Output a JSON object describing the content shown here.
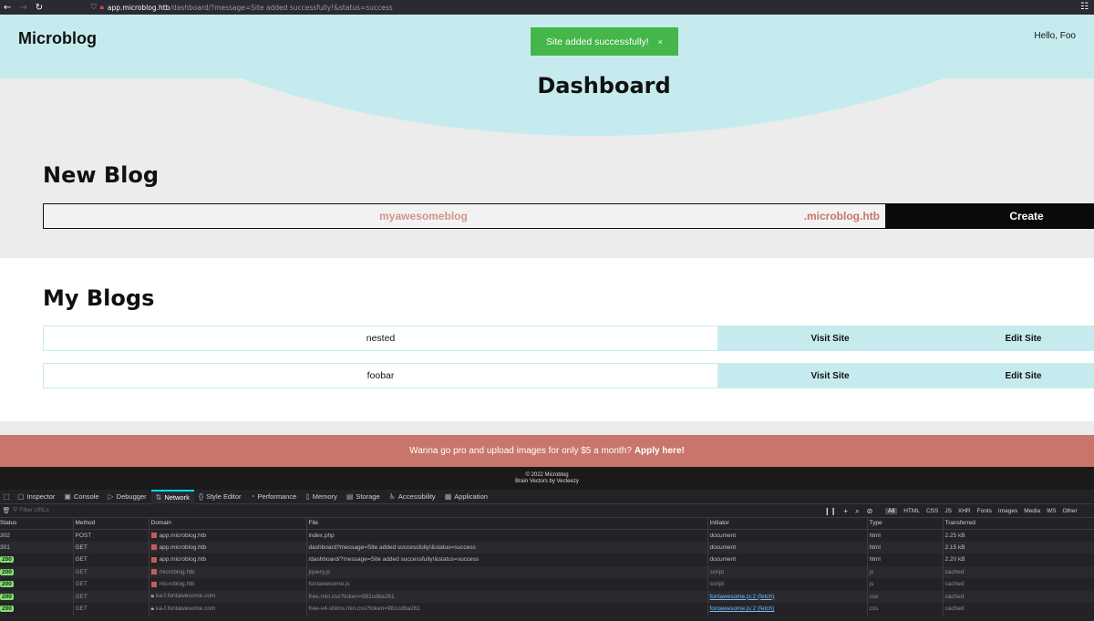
{
  "browser": {
    "url_host": "app.microblog.htb",
    "url_path": "/dashboard/?message=Site added successfully!&status=success"
  },
  "site": {
    "brand": "Microblog",
    "greeting": "Hello, Foo",
    "toast": {
      "message": "Site added successfully!",
      "close": "×"
    },
    "page_title": "Dashboard"
  },
  "new_blog": {
    "heading": "New Blog",
    "input_placeholder": "myawesomeblog",
    "suffix": ".microblog.htb",
    "create_label": "Create"
  },
  "my_blogs": {
    "heading": "My Blogs",
    "items": [
      {
        "name": "nested",
        "visit_label": "Visit Site",
        "edit_label": "Edit Site"
      },
      {
        "name": "foobar",
        "visit_label": "Visit Site",
        "edit_label": "Edit Site"
      }
    ]
  },
  "promo": {
    "text": "Wanna go pro and upload images for only $5 a month?",
    "link": "Apply here!"
  },
  "footer": {
    "copyright": "© 2022 Microblog",
    "credit": "Brain Vectors by Vecteezy"
  },
  "devtools": {
    "tabs": [
      "Inspector",
      "Console",
      "Debugger",
      "Network",
      "Style Editor",
      "Performance",
      "Memory",
      "Storage",
      "Accessibility",
      "Application"
    ],
    "active_tab": "Network",
    "filter_placeholder": "Filter URLs",
    "type_filters": [
      "All",
      "HTML",
      "CSS",
      "JS",
      "XHR",
      "Fonts",
      "Images",
      "Media",
      "WS",
      "Other"
    ],
    "columns": [
      "Status",
      "Method",
      "Domain",
      "File",
      "Initiator",
      "Type",
      "Transferred"
    ],
    "rows": [
      {
        "status": "302",
        "method": "POST",
        "domain": "app.microblog.htb",
        "file": "index.php",
        "initiator": "document",
        "type": "html",
        "transferred": "2.25 kB"
      },
      {
        "status": "301",
        "method": "GET",
        "domain": "app.microblog.htb",
        "file": "dashboard?message=Site added successfully!&status=success",
        "initiator": "document",
        "type": "html",
        "transferred": "2.15 kB"
      },
      {
        "status": "200",
        "method": "GET",
        "domain": "app.microblog.htb",
        "file": "/dashboard/?message=Site added successfully!&status=success",
        "initiator": "document",
        "type": "html",
        "transferred": "2.20 kB"
      },
      {
        "status": "200",
        "method": "GET",
        "domain": "microblog.htb",
        "file": "jquery.js",
        "initiator": "script",
        "type": "js",
        "transferred": "cached"
      },
      {
        "status": "200",
        "method": "GET",
        "domain": "microblog.htb",
        "file": "fontawesome.js",
        "initiator": "script",
        "type": "js",
        "transferred": "cached"
      },
      {
        "status": "200",
        "method": "GET",
        "domain": "ka-f.fontawesome.com",
        "file": "free.min.css?token=981cd6a261",
        "initiator": "fontawesome.js:2 (fetch)",
        "type": "css",
        "transferred": "cached"
      },
      {
        "status": "200",
        "method": "GET",
        "domain": "ka-f.fontawesome.com",
        "file": "free-v4-shims.min.css?token=981cd6a261",
        "initiator": "fontawesome.js:2 (fetch)",
        "type": "css",
        "transferred": "cached"
      }
    ]
  }
}
